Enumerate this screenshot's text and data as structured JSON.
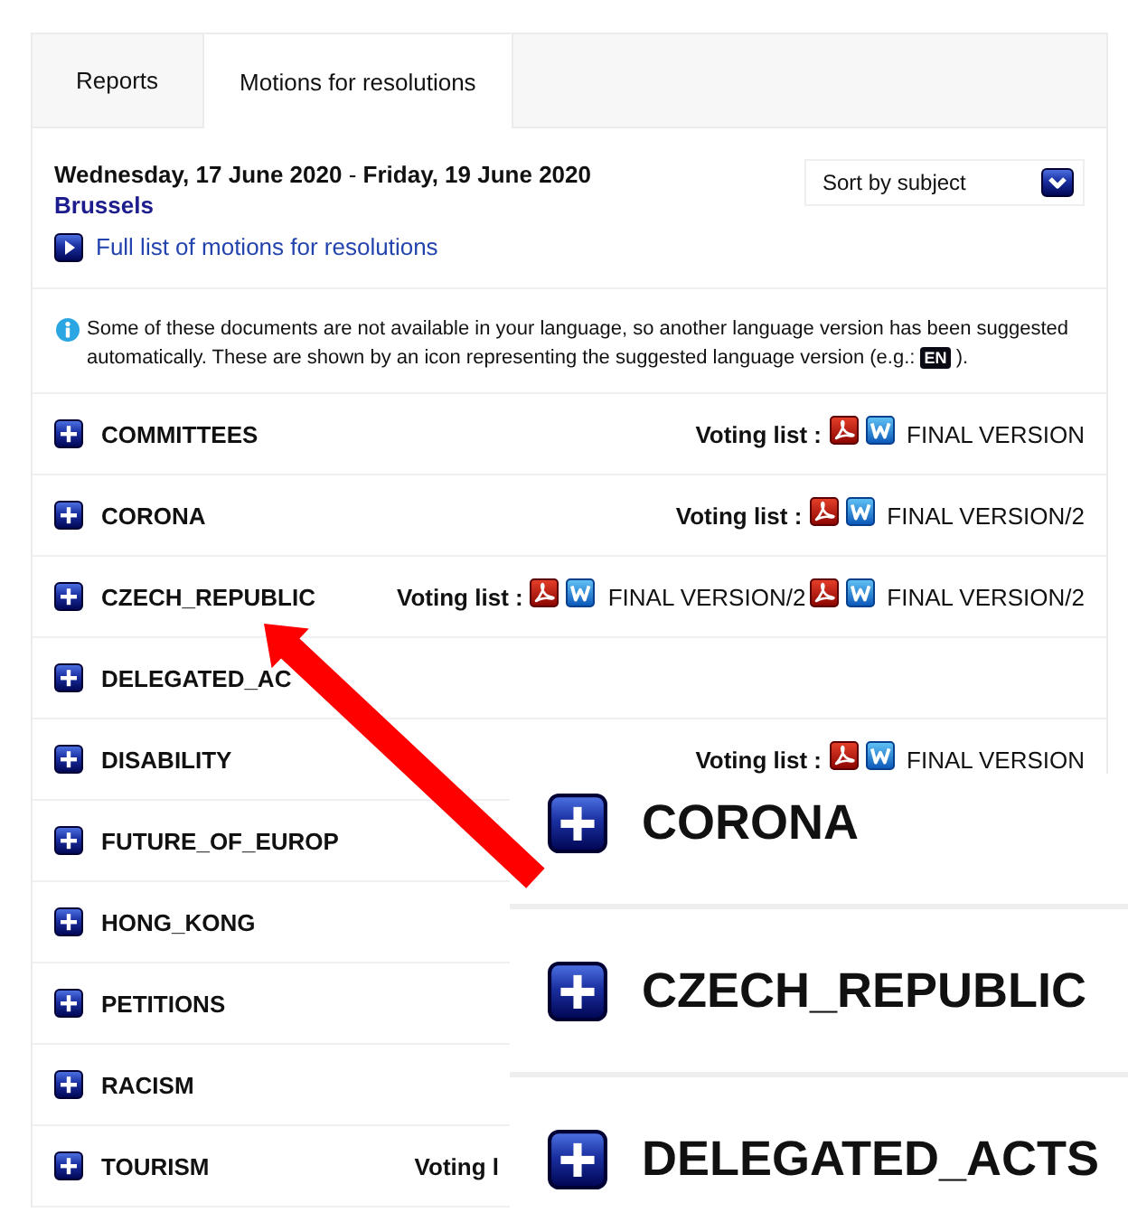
{
  "tabs": [
    {
      "label": "Reports",
      "selected": false
    },
    {
      "label": "Motions for resolutions",
      "selected": true
    }
  ],
  "session": {
    "date_range": "**Wednesday, 17 June 2020** - **Friday, 19 June 2020**",
    "place": "Brussels",
    "link": "Full list of motions for resolutions"
  },
  "sort": {
    "value": "Sort by subject"
  },
  "notice": {
    "text_before": "Some of these documents are not available in your language, so another language version has been suggested automatically. These are shown by an icon representing the suggested language version (e.g.:",
    "badge": "EN",
    "text_after": ")."
  },
  "topics": [
    {
      "name": "COMMITTEES",
      "expanded": false,
      "voting": {
        "label": "Voting list :",
        "versions": [
          "FINAL VERSION"
        ]
      }
    },
    {
      "name": "CORONA",
      "expanded": false,
      "voting": {
        "label": "Voting list :",
        "versions": [
          "FINAL VERSION/2"
        ]
      }
    },
    {
      "name": "CZECH_REPUBLIC",
      "expanded": false,
      "voting": {
        "label": "Voting list :",
        "versions": [
          "FINAL VERSION/2",
          "FINAL VERSION/2"
        ]
      }
    },
    {
      "name": "DELEGATED_AC",
      "expanded": false
    },
    {
      "name": "DISABILITY",
      "expanded": false,
      "voting": {
        "label": "Voting list :",
        "versions": [
          "FINAL VERSION"
        ]
      }
    },
    {
      "name": "FUTURE_OF_EUROP",
      "expanded": false
    },
    {
      "name": "HONG_KONG",
      "expanded": false
    },
    {
      "name": "PETITIONS",
      "expanded": false
    },
    {
      "name": "RACISM",
      "expanded": false
    },
    {
      "name": "TOURISM",
      "expanded": false,
      "voting": {
        "label": "Voting l"
      }
    }
  ],
  "zoom_inset": {
    "rows": [
      {
        "name": "CORONA",
        "expanded": false
      },
      {
        "name": "CZECH_REPUBLIC",
        "expanded": false
      },
      {
        "name": "DELEGATED_ACTS",
        "expanded": false
      }
    ]
  }
}
